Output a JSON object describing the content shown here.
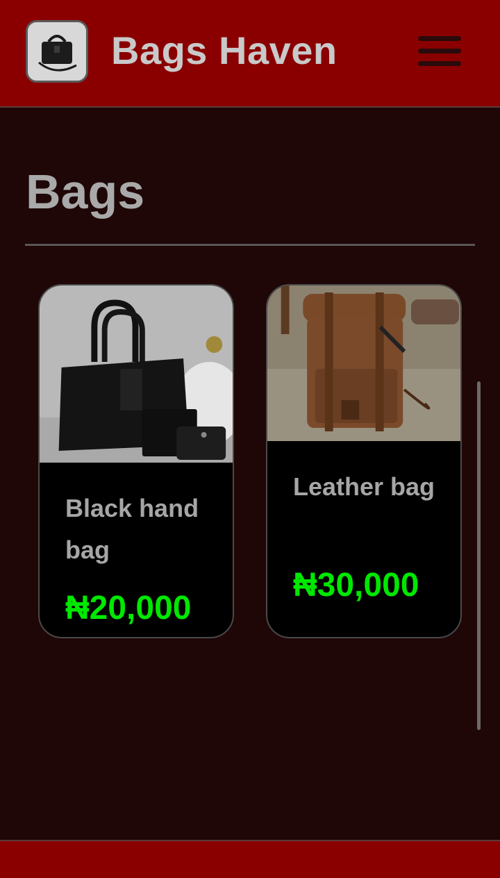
{
  "header": {
    "brand": "Bags Haven",
    "logo_icon": "handbag-logo-icon",
    "menu_icon": "hamburger-menu-icon"
  },
  "main": {
    "section_title": "Bags",
    "products": [
      {
        "name": "Black hand bag",
        "price": "₦20,000",
        "image_icon": "black-handbag-photo"
      },
      {
        "name": "Leather bag",
        "price": "₦30,000",
        "image_icon": "leather-backpack-photo"
      }
    ]
  },
  "colors": {
    "header_bg": "#8a0000",
    "page_bg": "#1f0607",
    "price_green": "#00e800",
    "card_bg": "#000000"
  }
}
